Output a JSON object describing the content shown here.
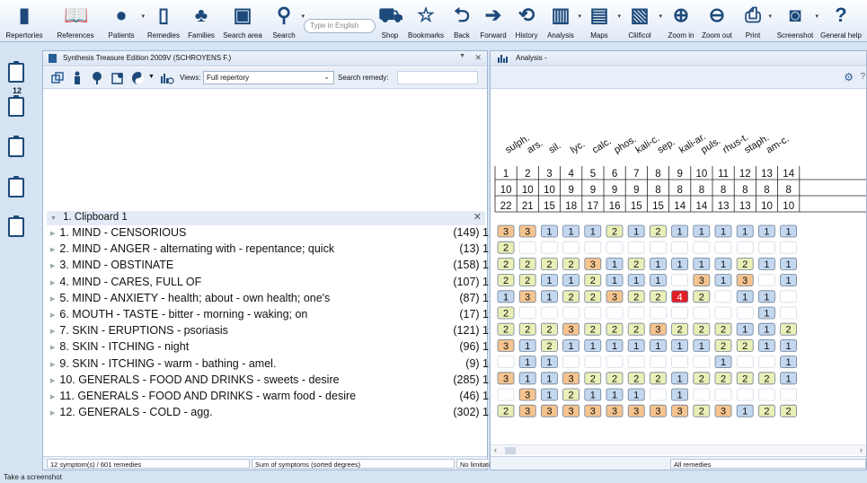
{
  "toolbar": {
    "items": [
      {
        "label": "Repertories",
        "icon": "book-icon",
        "dropdown": false
      },
      {
        "label": "References",
        "icon": "open-book-icon",
        "dropdown": false
      },
      {
        "label": "Patients",
        "icon": "patients-icon",
        "dropdown": true
      },
      {
        "label": "Remedies",
        "icon": "bottle-icon",
        "dropdown": false
      },
      {
        "label": "Families",
        "icon": "tree-icon",
        "dropdown": false
      },
      {
        "label": "Search area",
        "icon": "search-area-icon",
        "dropdown": false
      },
      {
        "label": "Search",
        "icon": "magnifier-icon",
        "dropdown": true
      },
      {
        "label": "Shop",
        "icon": "cart-icon",
        "dropdown": false
      },
      {
        "label": "Bookmarks",
        "icon": "star-icon",
        "dropdown": false
      },
      {
        "label": "Back",
        "icon": "back-arrow-icon",
        "dropdown": false
      },
      {
        "label": "Forward",
        "icon": "forward-arrow-icon",
        "dropdown": false
      },
      {
        "label": "History",
        "icon": "history-icon",
        "dropdown": false
      },
      {
        "label": "Analysis",
        "icon": "analysis-icon",
        "dropdown": true
      },
      {
        "label": "Maps",
        "icon": "maps-icon",
        "dropdown": true
      },
      {
        "label": "Cliificol",
        "icon": "clificol-icon",
        "dropdown": true
      },
      {
        "label": "Zoom in",
        "icon": "zoom-in-icon",
        "dropdown": false
      },
      {
        "label": "Zoom out",
        "icon": "zoom-out-icon",
        "dropdown": false
      },
      {
        "label": "Print",
        "icon": "printer-icon",
        "dropdown": true
      },
      {
        "label": "Screenshot",
        "icon": "camera-icon",
        "dropdown": true
      },
      {
        "label": "General help",
        "icon": "help-icon",
        "dropdown": false
      }
    ],
    "search_placeholder": "Type in English"
  },
  "clipboards": {
    "active_count": "12"
  },
  "left_panel": {
    "title": "Synthesis Treasure Edition 2009V (SCHROYENS F.)",
    "views_label": "Views:",
    "views_value": "Full repertory",
    "search_label": "Search remedy:",
    "clipboard_header": "1. Clipboard 1",
    "rubrics": [
      {
        "label": "1. MIND - CENSORIOUS",
        "count": "(149) 1"
      },
      {
        "label": "2. MIND - ANGER - alternating with - repentance; quick",
        "count": "(13) 1"
      },
      {
        "label": "3. MIND - OBSTINATE",
        "count": "(158) 1"
      },
      {
        "label": "4. MIND - CARES, FULL OF",
        "count": "(107) 1"
      },
      {
        "label": "5. MIND - ANXIETY - health; about - own health; one's",
        "count": "(87) 1"
      },
      {
        "label": "6. MOUTH - TASTE - bitter - morning - waking; on",
        "count": "(17) 1"
      },
      {
        "label": "7. SKIN - ERUPTIONS - psoriasis",
        "count": "(121) 1"
      },
      {
        "label": "8. SKIN - ITCHING - night",
        "count": "(96) 1"
      },
      {
        "label": "9. SKIN - ITCHING - warm - bathing - amel.",
        "count": "(9) 1"
      },
      {
        "label": "10. GENERALS - FOOD AND DRINKS - sweets - desire",
        "count": "(285) 1"
      },
      {
        "label": "11. GENERALS - FOOD AND DRINKS - warm food - desire",
        "count": "(46) 1"
      },
      {
        "label": "12. GENERALS - COLD - agg.",
        "count": "(302) 1"
      }
    ],
    "status": {
      "symptoms": "12 symptom(s) / 601 remedies",
      "sum": "Sum of symptoms (sorted degrees)",
      "limitation": "No limitation"
    }
  },
  "right_panel": {
    "tab_title": "Analysis -",
    "remedies": [
      "sulph.",
      "ars.",
      "sil.",
      "lyc.",
      "calc.",
      "phos.",
      "kali-c.",
      "sep.",
      "kali-ar.",
      "puls.",
      "rhus-t.",
      "staph.",
      "am-c."
    ],
    "ranks": [
      "1",
      "2",
      "3",
      "4",
      "5",
      "6",
      "7",
      "8",
      "9",
      "10",
      "11",
      "12",
      "13",
      "14"
    ],
    "counts": [
      "10",
      "10",
      "10",
      "9",
      "9",
      "9",
      "9",
      "8",
      "8",
      "8",
      "8",
      "8",
      "8",
      "8"
    ],
    "sums": [
      "22",
      "21",
      "15",
      "18",
      "17",
      "16",
      "15",
      "15",
      "14",
      "14",
      "13",
      "13",
      "10",
      "10"
    ],
    "grades": [
      [
        3,
        3,
        1,
        1,
        1,
        2,
        1,
        2,
        1,
        1,
        1,
        1,
        1,
        1
      ],
      [
        2,
        0,
        0,
        0,
        0,
        0,
        0,
        0,
        0,
        0,
        0,
        0,
        0,
        0
      ],
      [
        2,
        2,
        2,
        2,
        3,
        1,
        2,
        1,
        1,
        1,
        1,
        2,
        1,
        1
      ],
      [
        2,
        2,
        1,
        1,
        2,
        1,
        1,
        1,
        0,
        3,
        1,
        3,
        0,
        1
      ],
      [
        1,
        3,
        1,
        2,
        2,
        3,
        2,
        2,
        4,
        2,
        0,
        1,
        1,
        0
      ],
      [
        2,
        0,
        0,
        0,
        0,
        0,
        0,
        0,
        0,
        0,
        0,
        0,
        1,
        0
      ],
      [
        2,
        2,
        2,
        3,
        2,
        2,
        2,
        3,
        2,
        2,
        2,
        1,
        1,
        2
      ],
      [
        3,
        1,
        2,
        1,
        1,
        1,
        1,
        1,
        1,
        1,
        2,
        2,
        1,
        1
      ],
      [
        0,
        1,
        1,
        0,
        0,
        0,
        0,
        0,
        0,
        0,
        1,
        0,
        0,
        1
      ],
      [
        3,
        1,
        1,
        3,
        2,
        2,
        2,
        2,
        1,
        2,
        2,
        2,
        2,
        1
      ],
      [
        0,
        3,
        1,
        2,
        1,
        1,
        1,
        0,
        1,
        0,
        0,
        0,
        0,
        0
      ],
      [
        2,
        3,
        3,
        3,
        3,
        3,
        3,
        3,
        3,
        2,
        3,
        1,
        2,
        2
      ]
    ],
    "grade_colors": {
      "1": "#c3d7ef",
      "2": "#e9efb6",
      "3": "#f6c48f",
      "4": "#e21f26"
    },
    "status": {
      "remedies": "All remedies"
    }
  },
  "bottom_status": "Take a screenshot"
}
